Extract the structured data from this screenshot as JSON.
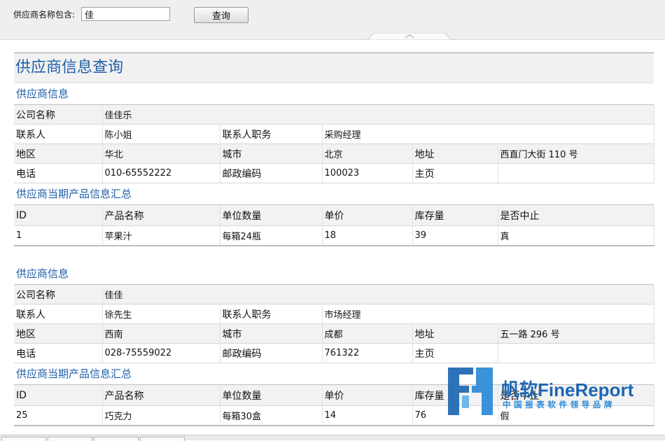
{
  "param": {
    "label": "供应商名称包含:",
    "value": "佳",
    "query_label": "查询"
  },
  "report": {
    "title": "供应商信息查询",
    "blocks": [
      {
        "info_title": "供应商信息",
        "company_label": "公司名称",
        "company": "佳佳乐",
        "contact_label": "联系人",
        "contact": "陈小姐",
        "position_label": "联系人职务",
        "position": "采购经理",
        "region_label": "地区",
        "region": "华北",
        "city_label": "城市",
        "city": "北京",
        "address_label": "地址",
        "address": "西直门大街 110 号",
        "phone_label": "电话",
        "phone": "010-65552222",
        "postcode_label": "邮政编码",
        "postcode": "100023",
        "homepage_label": "主页",
        "homepage": "",
        "product_title": "供应商当期产品信息汇总",
        "columns": [
          "ID",
          "产品名称",
          "单位数量",
          "单价",
          "库存量",
          "是否中止"
        ],
        "rows": [
          [
            "1",
            "苹果汁",
            "每箱24瓶",
            "18",
            "39",
            "真"
          ]
        ]
      },
      {
        "info_title": "供应商信息",
        "company_label": "公司名称",
        "company": "佳佳",
        "contact_label": "联系人",
        "contact": "徐先生",
        "position_label": "联系人职务",
        "position": "市场经理",
        "region_label": "地区",
        "region": "西南",
        "city_label": "城市",
        "city": "成都",
        "address_label": "地址",
        "address": "五一路 296 号",
        "phone_label": "电话",
        "phone": "028-75559022",
        "postcode_label": "邮政编码",
        "postcode": "761322",
        "homepage_label": "主页",
        "homepage": "",
        "product_title": "供应商当期产品信息汇总",
        "columns": [
          "ID",
          "产品名称",
          "单位数量",
          "单价",
          "库存量",
          "是否中止"
        ],
        "rows": [
          [
            "25",
            "巧克力",
            "每箱30盒",
            "14",
            "76",
            "假"
          ]
        ]
      }
    ]
  },
  "watermark": {
    "brand": "帆软FineReport",
    "tagline": "中国报表软件领导品牌"
  },
  "colors": {
    "title_blue": "#1f5fa8",
    "watermark_blue": "#1d67b3",
    "toolbar_bg": "#efefef"
  }
}
